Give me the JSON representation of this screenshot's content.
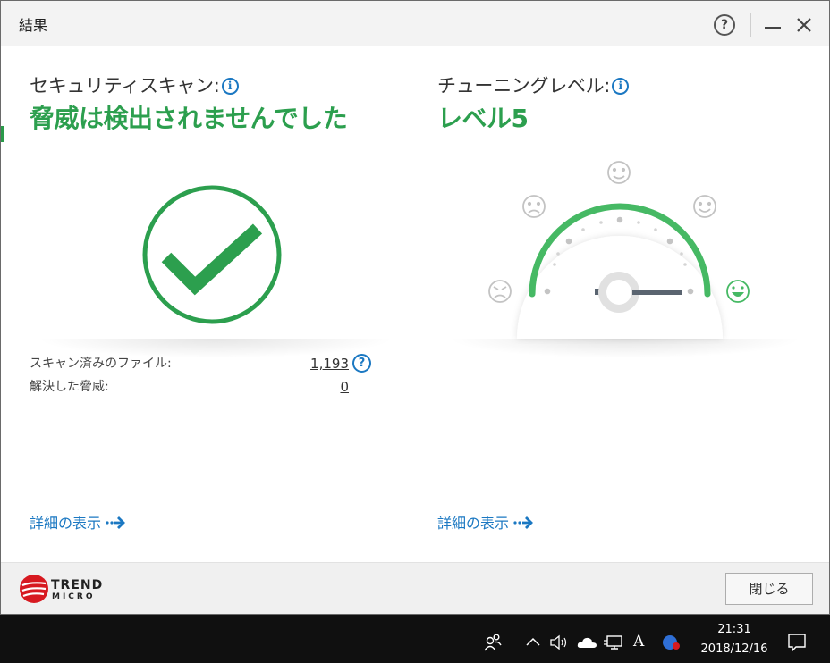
{
  "window": {
    "title": "結果",
    "help_label": "?"
  },
  "scan": {
    "label": "セキュリティスキャン:",
    "info_label": "i",
    "status": "脅威は検出されませんでした",
    "files_label": "スキャン済みのファイル:",
    "files_value": "1,193",
    "resolved_label": "解決した脅威:",
    "resolved_value": "0",
    "details_link": "詳細の表示"
  },
  "tuning": {
    "label": "チューニングレベル:",
    "info_label": "i",
    "status": "レベル5",
    "level": 5,
    "max_level": 5,
    "details_link": "詳細の表示"
  },
  "footer": {
    "logo_line1": "TREND",
    "logo_line2": "MICRO",
    "close_button": "閉じる"
  },
  "taskbar": {
    "time": "21:31",
    "date": "2018/12/16",
    "ime_label": "A"
  },
  "colors": {
    "accent_green": "#2c9f4e",
    "link_blue": "#1b78c2",
    "brand_red": "#d71920"
  }
}
